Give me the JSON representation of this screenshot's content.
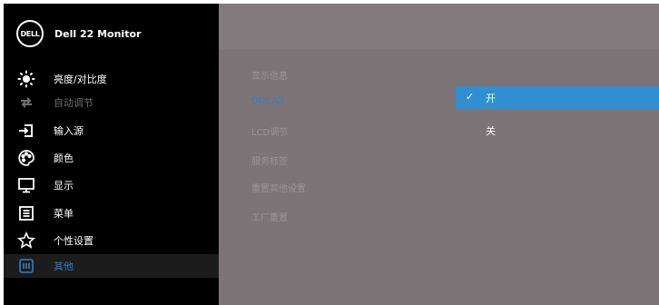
{
  "brand": {
    "logo_text": "DELL",
    "model": "Dell 22 Monitor"
  },
  "menu": [
    {
      "label": "亮度/对比度",
      "icon": "brightness-icon"
    },
    {
      "label": "自动调节",
      "icon": "auto-adjust-icon"
    },
    {
      "label": "输入源",
      "icon": "input-source-icon"
    },
    {
      "label": "颜色",
      "icon": "color-palette-icon"
    },
    {
      "label": "显示",
      "icon": "display-monitor-icon"
    },
    {
      "label": "菜单",
      "icon": "menu-icon"
    },
    {
      "label": "个性设置",
      "icon": "star-icon"
    },
    {
      "label": "其他",
      "icon": "other-info-icon"
    }
  ],
  "submenu": [
    "显示信息",
    "DDC/CI",
    "LCD调节",
    "服务标签",
    "重置其他设置",
    "工厂重置"
  ],
  "options": {
    "on": "开",
    "off": "关",
    "check": "✓"
  },
  "colors": {
    "accent": "#2f8fd0",
    "panel": "#7d7477",
    "sidebar": "#000000"
  }
}
